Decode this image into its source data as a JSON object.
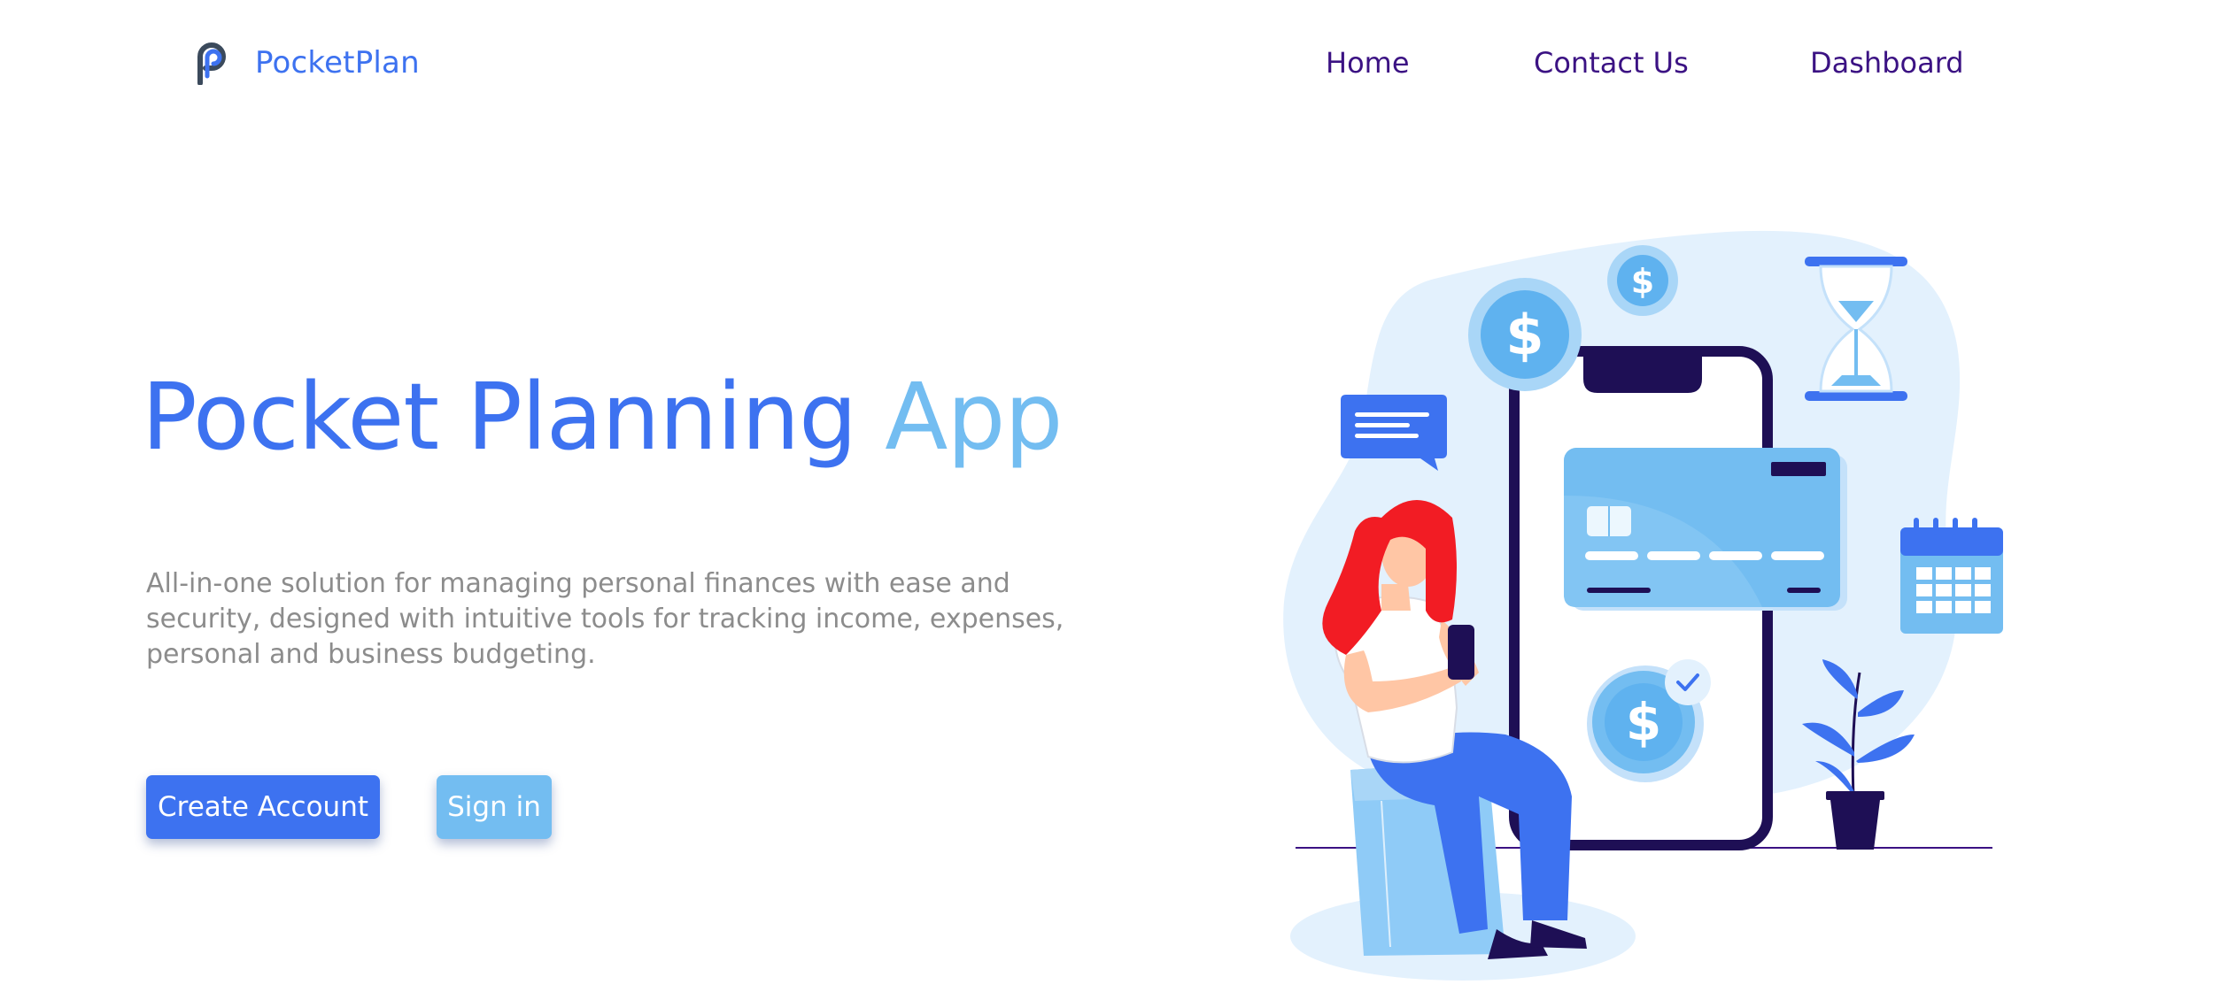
{
  "nav": {
    "brand": "PocketPlan",
    "brand_icon": "pocketplan-logo-icon",
    "links": [
      {
        "label": "Home"
      },
      {
        "label": "Contact Us"
      },
      {
        "label": "Dashboard"
      }
    ]
  },
  "hero": {
    "title_main": "Pocket Planning",
    "title_accent": "App",
    "description": "All-in-one solution for managing personal finances with ease and security, designed with intuitive tools for tracking income, expenses, personal and business budgeting.",
    "primary_button": "Create Account",
    "secondary_button": "Sign in"
  },
  "illustration": {
    "coin_symbol": "$",
    "icons": [
      "dollar-coin-icon",
      "chat-bubble-icon",
      "hourglass-icon",
      "credit-card-icon",
      "calendar-icon",
      "plant-icon",
      "checkmark-icon"
    ]
  },
  "colors": {
    "brand_blue": "#3d72f0",
    "light_blue": "#73bdf1",
    "nav_purple": "#3b1283",
    "text_gray": "#8c8c8c",
    "phone_dark": "#1e0f55",
    "hair_red": "#f21c24"
  }
}
